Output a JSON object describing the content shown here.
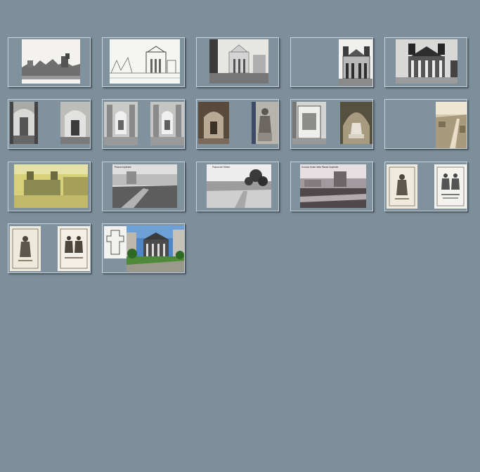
{
  "gallery": {
    "thumbnails": [
      {
        "caption": "",
        "kind": "ruins-engraving"
      },
      {
        "caption": "",
        "kind": "church-facade-sketch"
      },
      {
        "caption": "",
        "kind": "church-street-photo"
      },
      {
        "caption": "",
        "kind": "church-facade-photo"
      },
      {
        "caption": "",
        "kind": "church-portico-photo"
      },
      {
        "caption": "",
        "kind": "church-interior-pair"
      },
      {
        "caption": "",
        "kind": "altar-interior-pair"
      },
      {
        "caption": "",
        "kind": "chapel-statue-pair"
      },
      {
        "caption": "",
        "kind": "tomb-monument-pair"
      },
      {
        "caption": "",
        "kind": "city-aerial-photo"
      },
      {
        "caption": "",
        "kind": "colored-postcard-square"
      },
      {
        "caption": "Piazza Imperiale",
        "kind": "demolition-photo"
      },
      {
        "caption": "Piazza del Ortiere",
        "kind": "street-trees-photo"
      },
      {
        "caption": "Il nuovo fronte della Piazza Imperiale",
        "kind": "square-photo"
      },
      {
        "caption": "",
        "kind": "holy-cards-pair"
      },
      {
        "caption": "",
        "kind": "holy-cards-pair-2"
      },
      {
        "caption": "",
        "kind": "plan-and-modern-photo"
      }
    ]
  },
  "colors": {
    "background": "#7d8f9b",
    "thumb_panel": "#7f929e",
    "thumb_border": "#c9d3d9"
  }
}
